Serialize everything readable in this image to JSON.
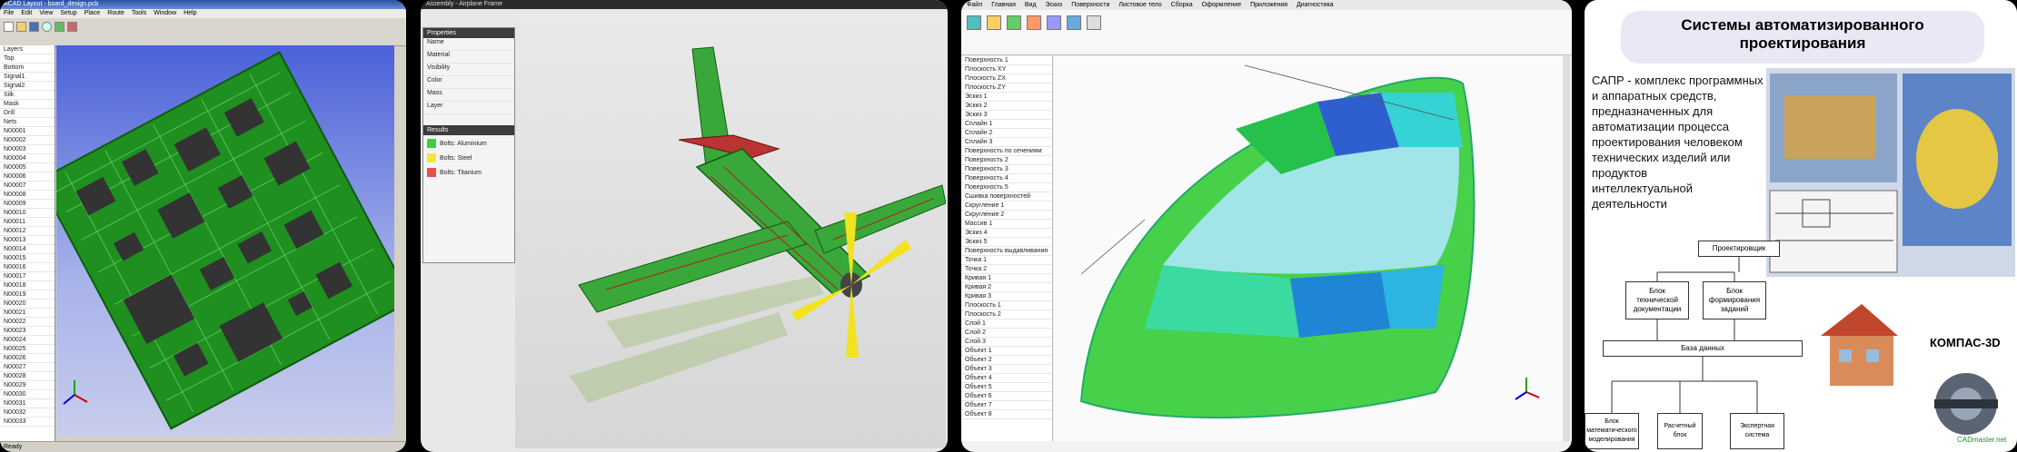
{
  "panel1": {
    "title": "ACAD Layout - board_design.pcb",
    "menu": [
      "File",
      "Edit",
      "View",
      "Setup",
      "Place",
      "Route",
      "Tools",
      "Window",
      "Help"
    ],
    "tree": [
      "Layers",
      "Top",
      "Bottom",
      "Signal1",
      "Signal2",
      "Silk",
      "Mask",
      "Drill",
      "Nets",
      "N00001",
      "N00002",
      "N00003",
      "N00004",
      "N00005",
      "N00006",
      "N00007",
      "N00008",
      "N00009",
      "N00010",
      "N00011",
      "N00012",
      "N00013",
      "N00014",
      "N00015",
      "N00016",
      "N00017",
      "N00018",
      "N00019",
      "N00020",
      "N00021",
      "N00022",
      "N00023",
      "N00024",
      "N00025",
      "N00026",
      "N00027",
      "N00028",
      "N00029",
      "N00030",
      "N00031",
      "N00032",
      "N00033"
    ],
    "status": "Ready"
  },
  "panel2": {
    "title": "Assembly - Airplane Frame",
    "props_header": "Properties",
    "props": [
      "Name",
      "Material",
      "Visibility",
      "Color",
      "Mass",
      "Layer"
    ],
    "results_header": "Results",
    "legend": [
      {
        "label": "Bolts: Aluminium",
        "color": "#3ecf3e"
      },
      {
        "label": "Bolts: Steel",
        "color": "#f5e53a"
      },
      {
        "label": "Bolts: Titanium",
        "color": "#e85050"
      }
    ]
  },
  "panel3": {
    "ribbon_tabs": [
      "Файл",
      "Главная",
      "Вид",
      "Эскиз",
      "Поверхности",
      "Листовое тело",
      "Сборка",
      "Оформление",
      "Приложения",
      "Диагностика"
    ],
    "tree_items": [
      "Поверхность 1",
      "Плоскость XY",
      "Плоскость ZX",
      "Плоскость ZY",
      "Эскиз 1",
      "Эскиз 2",
      "Эскиз 3",
      "Сплайн 1",
      "Сплайн 2",
      "Сплайн 3",
      "Поверхность по сечениям",
      "Поверхность 2",
      "Поверхность 3",
      "Поверхность 4",
      "Поверхность 5",
      "Сшивка поверхностей",
      "Скругление 1",
      "Скругление 2",
      "Массив 1",
      "Эскиз 4",
      "Эскиз 5",
      "Поверхность выдавливания",
      "Точка 1",
      "Точка 2",
      "Кривая 1",
      "Кривая 2",
      "Кривая 3",
      "Плоскость 1",
      "Плоскость 2",
      "Слой 1",
      "Слой 2",
      "Слой 3",
      "Объект 1",
      "Объект 2",
      "Объект 3",
      "Объект 4",
      "Объект 5",
      "Объект 6",
      "Объект 7",
      "Объект 8"
    ]
  },
  "panel4": {
    "title_line1": "Системы автоматизированного",
    "title_line2": "проектирования",
    "text_lines": [
      "САПР - комплекс программных",
      "и аппаратных средств,",
      "предназначенных для",
      "автоматизации процесса",
      "проектирования человеком",
      "технических изделий или",
      "продуктов",
      "интеллектуальной",
      "деятельности"
    ],
    "diagram": {
      "top": "Проектировщик",
      "mid_left": "Блок\nтехнической\nдокументации",
      "mid_right": "Блок\nформирования\nзаданий",
      "bus": "База данных",
      "bottom": [
        "Блок\nматематического\nмоделирования",
        "Расчетный\nблок",
        "Экспертная\nсистема"
      ]
    },
    "brand": "КОМПАС-3D",
    "watermark": "CADmaster.net"
  }
}
